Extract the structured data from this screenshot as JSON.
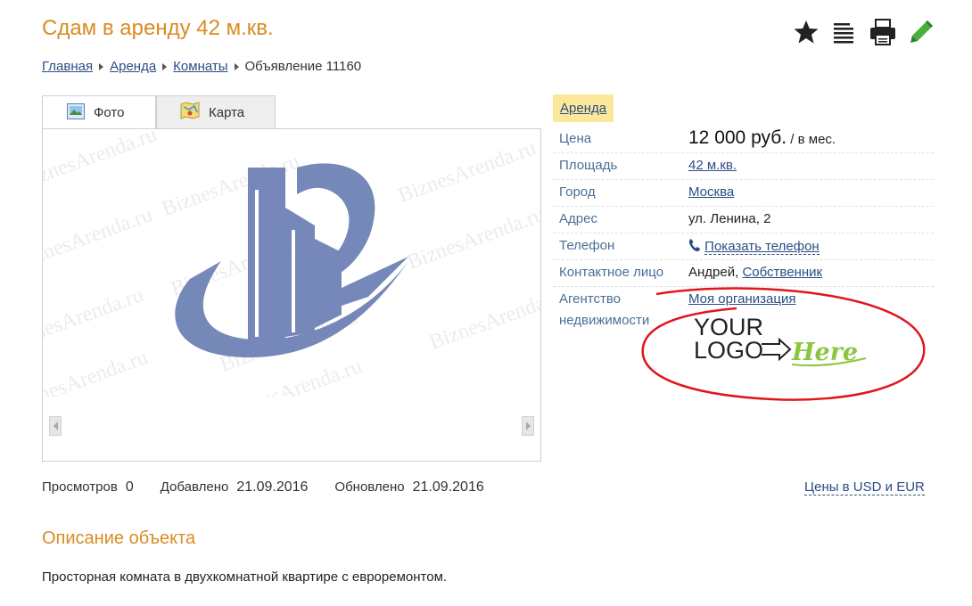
{
  "page": {
    "title": "Сдам в аренду 42 м.кв."
  },
  "toolbar": {
    "icons": [
      "star-icon",
      "list-icon",
      "printer-icon",
      "pencil-icon"
    ]
  },
  "breadcrumb": {
    "items": [
      "Главная",
      "Аренда",
      "Комнаты"
    ],
    "current": "Объявление 11160"
  },
  "tabs": {
    "photo": "Фото",
    "map": "Карта"
  },
  "gallery": {
    "watermark": "BiznesArenda.ru"
  },
  "listing": {
    "type_badge": "Аренда",
    "price_label": "Цена",
    "price_value": "12 000 руб.",
    "price_unit": "/ в мес.",
    "area_label": "Площадь",
    "area_value": "42 м.кв.",
    "city_label": "Город",
    "city_value": "Москва",
    "address_label": "Адрес",
    "address_value": "ул. Ленина, 2",
    "phone_label": "Телефон",
    "phone_link": "Показать телефон",
    "contact_label": "Контактное лицо",
    "contact_name": "Андрей,",
    "contact_role": "Собственник",
    "agency_label": "Агентство недвижимости",
    "agency_link": "Моя организация",
    "agency_logo_line1": "YOUR",
    "agency_logo_line2": "LOGO",
    "agency_logo_line3": "Here"
  },
  "stats": {
    "views_label": "Просмотров",
    "views_value": "0",
    "added_label": "Добавлено",
    "added_value": "21.09.2016",
    "updated_label": "Обновлено",
    "updated_value": "21.09.2016",
    "prices_link": "Цены в USD и EUR"
  },
  "description": {
    "title": "Описание объекта",
    "text": "Просторная комната в двухкомнатной квартире с евроремонтом."
  },
  "colors": {
    "accent": "#d98b23",
    "link": "#2b4d82",
    "label": "#4a6f95",
    "badge": "#fbe89a",
    "logo": "#6b80b4",
    "annotation": "#e0161b",
    "logo_green": "#8cc63f"
  }
}
